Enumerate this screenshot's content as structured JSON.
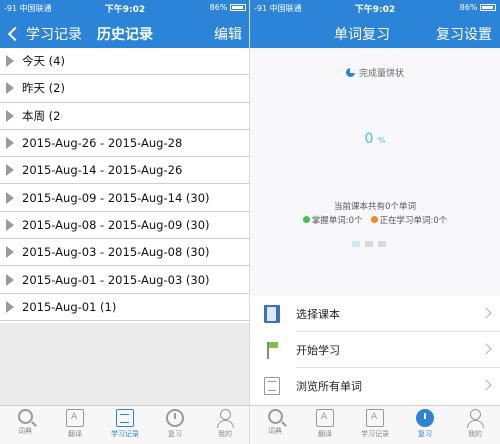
{
  "colors": {
    "accent": "#2c84d8",
    "percent": "#4db8e8",
    "mastered": "#3cc64a",
    "learning": "#f08a24"
  },
  "left": {
    "status": {
      "carrier": "-91 中国联通",
      "time": "下午9:02",
      "battery": "86%"
    },
    "nav": {
      "back_label": "学习记录",
      "title": "历史记录",
      "edit_label": "编辑"
    },
    "history": [
      {
        "label": "今天 (4)"
      },
      {
        "label": "昨天 (2)"
      },
      {
        "label": "本周 (2"
      },
      {
        "label": "2015-Aug-26 - 2015-Aug-28"
      },
      {
        "label": "2015-Aug-14 - 2015-Aug-26"
      },
      {
        "label": "2015-Aug-09 - 2015-Aug-14 (30)"
      },
      {
        "label": "2015-Aug-08 - 2015-Aug-09 (30)"
      },
      {
        "label": "2015-Aug-03 - 2015-Aug-08 (30)"
      },
      {
        "label": "2015-Aug-01 - 2015-Aug-03 (30)"
      },
      {
        "label": "2015-Aug-01 (1)"
      }
    ],
    "tabs": [
      {
        "label": "词典",
        "icon": "search-icon"
      },
      {
        "label": "翻译",
        "icon": "translate-icon"
      },
      {
        "label": "学习记录",
        "icon": "document-icon"
      },
      {
        "label": "复习",
        "icon": "clock-icon"
      },
      {
        "label": "我的",
        "icon": "person-icon"
      }
    ]
  },
  "right": {
    "status": {
      "carrier": "-91 中国联通",
      "time": "下午9:02",
      "battery": "86%"
    },
    "nav": {
      "title": "单词复习",
      "settings_label": "复习设置"
    },
    "chart": {
      "title": "完成量饼状",
      "percent": "0",
      "percent_unit": "%"
    },
    "summary": "当前课本共有0个单词",
    "legend": {
      "mastered": "掌握单词:0个",
      "learning": "正在学习单词:0个"
    },
    "menu": [
      {
        "label": "选择课本",
        "icon": "book-icon"
      },
      {
        "label": "开始学习",
        "icon": "flag-icon"
      },
      {
        "label": "浏览所有单词",
        "icon": "list-icon"
      }
    ],
    "tabs": [
      {
        "label": "词典",
        "icon": "search-icon"
      },
      {
        "label": "翻译",
        "icon": "translate-icon"
      },
      {
        "label": "学习记录",
        "icon": "document-icon"
      },
      {
        "label": "复习",
        "icon": "clock-icon"
      },
      {
        "label": "我的",
        "icon": "person-icon"
      }
    ]
  }
}
